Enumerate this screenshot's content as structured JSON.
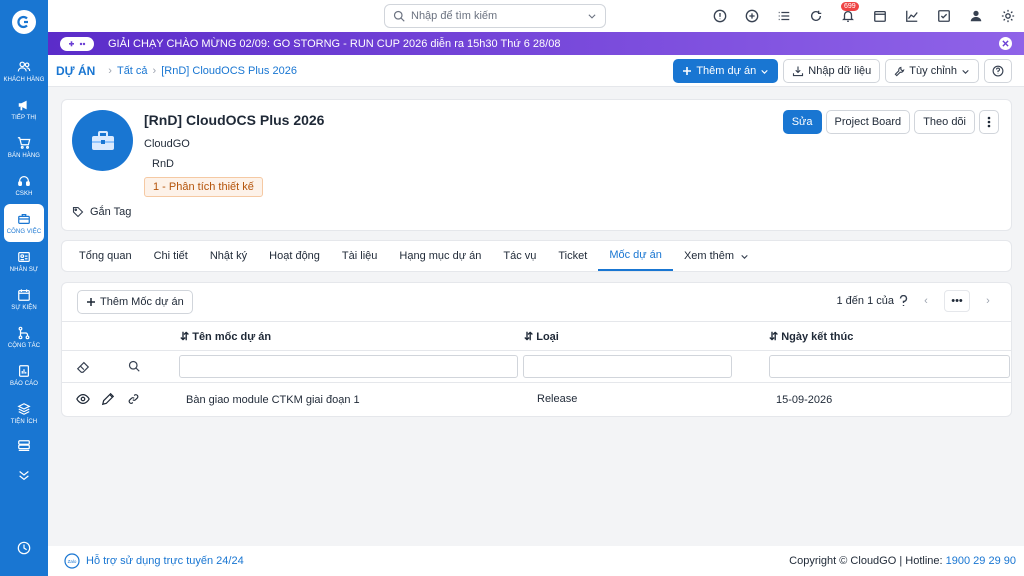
{
  "search": {
    "placeholder": "Nhập để tìm kiếm"
  },
  "topbar": {
    "notification_count": "699"
  },
  "banner": {
    "text": "GIẢI CHẠY CHÀO MỪNG 02/09: GO STORNG - RUN CUP 2026 diễn ra 15h30 Thứ 6 28/08"
  },
  "sidebar": {
    "items": [
      {
        "label": "KHÁCH HÀNG",
        "icon": "users-icon"
      },
      {
        "label": "TIẾP THỊ",
        "icon": "megaphone-icon"
      },
      {
        "label": "BÁN HÀNG",
        "icon": "cart-icon"
      },
      {
        "label": "CSKH",
        "icon": "headset-icon"
      },
      {
        "label": "CÔNG VIỆC",
        "icon": "briefcase-icon",
        "active": true
      },
      {
        "label": "NHÂN SỰ",
        "icon": "id-card-icon"
      },
      {
        "label": "SỰ KIỆN",
        "icon": "calendar-icon"
      },
      {
        "label": "CỘNG TÁC",
        "icon": "share-icon"
      },
      {
        "label": "BÁO CÁO",
        "icon": "report-icon"
      },
      {
        "label": "TIỆN ÍCH",
        "icon": "layers-icon"
      }
    ]
  },
  "breadcrumb": {
    "module": "DỰ ÁN",
    "all": "Tất cả",
    "current": "[RnD] CloudOCS Plus 2026"
  },
  "toolbar": {
    "add_project": "Thêm dự án",
    "import_data": "Nhập dữ liệu",
    "customize": "Tùy chỉnh"
  },
  "project": {
    "name": "[RnD] CloudOCS Plus 2026",
    "company": "CloudGO",
    "department": "RnD",
    "stage": "1 - Phân tích thiết kế",
    "tag_label": "Gắn Tag",
    "edit_label": "Sửa",
    "board_label": "Project Board",
    "follow_label": "Theo dõi"
  },
  "tabs": [
    {
      "label": "Tổng quan"
    },
    {
      "label": "Chi tiết"
    },
    {
      "label": "Nhật ký"
    },
    {
      "label": "Hoạt động"
    },
    {
      "label": "Tài liệu"
    },
    {
      "label": "Hạng mục dự án"
    },
    {
      "label": "Tác vụ"
    },
    {
      "label": "Ticket"
    },
    {
      "label": "Mốc dự án",
      "active": true
    },
    {
      "label": "Xem thêm"
    }
  ],
  "milestones": {
    "add_label": "Thêm Mốc dự án",
    "pager_text": "1 đến 1 của",
    "columns": [
      "Tên mốc dự án",
      "Loại",
      "Ngày kết thúc"
    ],
    "rows": [
      {
        "name": "Bàn giao module CTKM giai đoạn 1",
        "type": "Release",
        "end_date": "15-09-2026"
      }
    ]
  },
  "footer": {
    "support": "Hỗ trợ sử dụng trực tuyến 24/24",
    "copyright": "Copyright © CloudGO",
    "hotline_label": "Hotline:",
    "hotline": "1900 29 29 90"
  },
  "colors": {
    "primary": "#1976d2",
    "banner": "#6b3fd4"
  }
}
